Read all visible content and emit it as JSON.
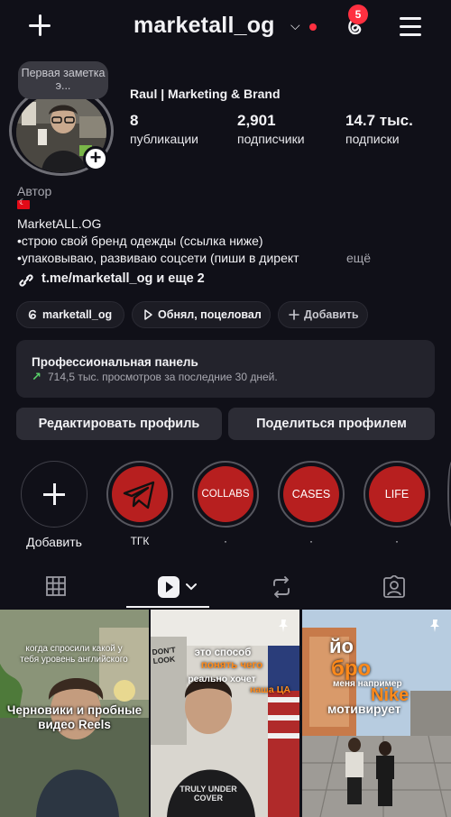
{
  "header": {
    "username": "marketall_og",
    "notification_count": "5"
  },
  "profile": {
    "note": "Первая заметка э...",
    "display_name": "Raul | Marketing & Brand",
    "stats": [
      {
        "value": "8",
        "label": "публикации"
      },
      {
        "value": "2,901",
        "label": "подписчики"
      },
      {
        "value": "14.7 тыс.",
        "label": "подписки"
      }
    ],
    "category": "Автор",
    "bio_lines": [
      "MarketALL.OG",
      "•строю свой бренд одежды (ссылка ниже)",
      "•упаковываю, развиваю соцсети (пиши в директ"
    ],
    "more": "ещё",
    "link": "t.me/marketall_og и еще 2"
  },
  "chips": [
    {
      "label": "marketall_og",
      "icon": "threads-icon"
    },
    {
      "label": "Обнял, поцеловал",
      "icon": "play-icon"
    },
    {
      "label": "Добавить",
      "icon": "plus-icon"
    }
  ],
  "pro_panel": {
    "title": "Профессиональная панель",
    "subtitle": "714,5 тыс. просмотров за последние 30 дней."
  },
  "actions": {
    "edit": "Редактировать профиль",
    "share": "Поделиться профилем"
  },
  "highlights": [
    {
      "title": "Добавить",
      "cover": ""
    },
    {
      "title": "ТГК",
      "cover": ""
    },
    {
      "title": "·",
      "cover": "COLLABS"
    },
    {
      "title": "·",
      "cover": "CASES"
    },
    {
      "title": "·",
      "cover": "LIFE"
    }
  ],
  "grid": [
    {
      "top_text": "когда спросили какой у тебя уровень английского",
      "main_text": "Черновики и пробные видео Reels"
    },
    {
      "sign_text": "DON'T LOOK",
      "line1": "это способ",
      "line2": "понять чего",
      "line3": "реально хочет",
      "line4": "наша ЦА",
      "shirt_text": "TRULY UNDER COVER",
      "pinned": true
    },
    {
      "line1": "йо",
      "line2": "бро",
      "line3": "меня например",
      "line4": "Nike",
      "line5": "мотивирует",
      "pinned": true
    }
  ],
  "colors": {
    "background": "#101018",
    "accent_red": "#ff3040",
    "highlight_red": "#b71f1f",
    "panel": "#23232c",
    "button": "#2c2c35",
    "growth_green": "#5ad36a",
    "text_orange": "#ff8a1a"
  }
}
